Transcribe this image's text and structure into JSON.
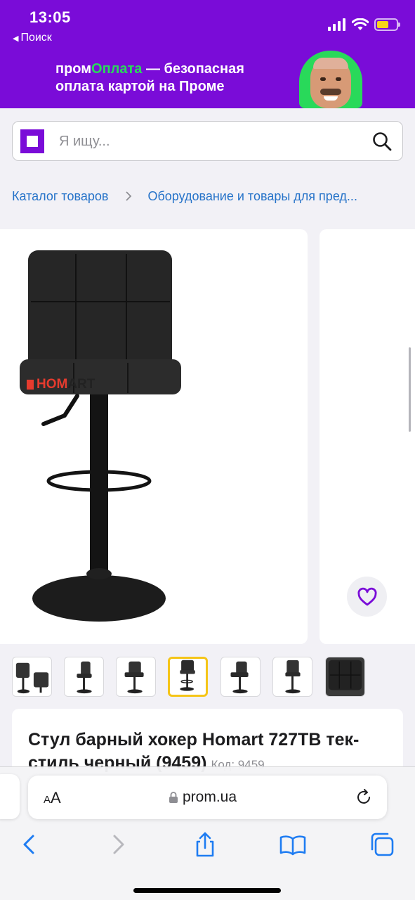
{
  "status_bar": {
    "time": "13:05",
    "back_app": "Поиск",
    "icons": [
      "cellular-icon",
      "wifi-icon",
      "battery-icon"
    ],
    "battery_level": 0.6
  },
  "promo": {
    "brand_prefix": "пром",
    "brand_highlight": "Оплата",
    "text_rest": " — безопасная оплата картой на Проме",
    "colors": {
      "background": "#7a0cd8",
      "highlight": "#29d95a"
    }
  },
  "search": {
    "placeholder": "Я ищу..."
  },
  "breadcrumb": {
    "items": [
      "Каталог товаров",
      "Оборудование и товары для пред..."
    ]
  },
  "gallery": {
    "brand_watermark_left": "HOM",
    "brand_watermark_right": "ART",
    "thumbnails": 7,
    "active_thumbnail": 4
  },
  "product": {
    "title": "Стул барный хокер Homart 727TB тек-стиль черный (9459)",
    "code": "Код: 9459"
  },
  "safari": {
    "text_size_label_small": "A",
    "text_size_label_large": "A",
    "url": "prom.ua"
  },
  "colors": {
    "accent": "#7a0cd8",
    "link": "#2673c9",
    "safari_blue": "#1e7cf2",
    "active_thumb": "#f5c518"
  }
}
